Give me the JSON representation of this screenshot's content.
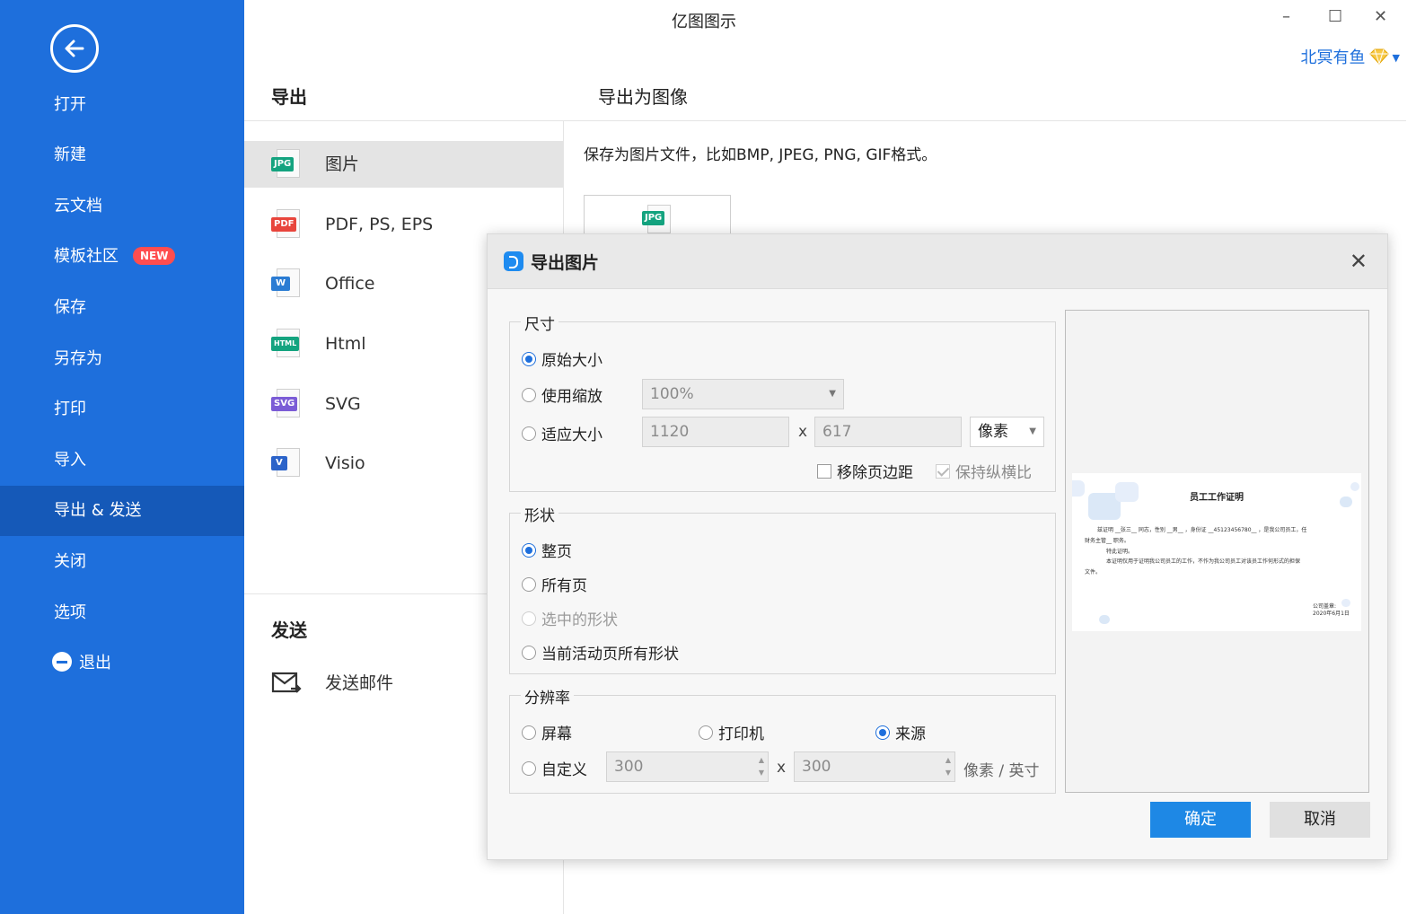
{
  "app": {
    "title": "亿图图示"
  },
  "window": {
    "minimize": "–",
    "maximize": "☐",
    "close": "✕"
  },
  "user": {
    "name": "北冥有鱼"
  },
  "sidebar": {
    "items": [
      {
        "label": "打开"
      },
      {
        "label": "新建"
      },
      {
        "label": "云文档"
      },
      {
        "label": "模板社区",
        "badge": "NEW"
      },
      {
        "label": "保存"
      },
      {
        "label": "另存为"
      },
      {
        "label": "打印"
      },
      {
        "label": "导入"
      },
      {
        "label": "导出 & 发送",
        "active": true
      },
      {
        "label": "关闭"
      },
      {
        "label": "选项"
      },
      {
        "label": "退出"
      }
    ]
  },
  "export": {
    "heading": "导出",
    "formats": [
      {
        "label": "图片",
        "tag": "JPG",
        "color": "#14a37f"
      },
      {
        "label": "PDF, PS, EPS",
        "tag": "PDF",
        "color": "#e8453c"
      },
      {
        "label": "Office",
        "tag": "W",
        "color": "#2b7cd3"
      },
      {
        "label": "Html",
        "tag": "HTML",
        "color": "#14a37f"
      },
      {
        "label": "SVG",
        "tag": "SVG",
        "color": "#7b5cd6"
      },
      {
        "label": "Visio",
        "tag": "V",
        "color": "#2b63c9"
      }
    ]
  },
  "send": {
    "heading": "发送",
    "mail_label": "发送邮件"
  },
  "right": {
    "heading": "导出为图像",
    "description": "保存为图片文件，比如BMP, JPEG, PNG, GIF格式。",
    "thumb_tag": "JPG"
  },
  "dialog": {
    "title": "导出图片",
    "close": "✕",
    "size": {
      "legend": "尺寸",
      "original": "原始大小",
      "use_scale": "使用缩放",
      "scale_value": "100%",
      "fit": "适应大小",
      "width": "1120",
      "height": "617",
      "x": "x",
      "unit": "像素",
      "remove_margin": "移除页边距",
      "keep_ratio": "保持纵横比"
    },
    "shape": {
      "legend": "形状",
      "whole_page": "整页",
      "all_pages": "所有页",
      "selected": "选中的形状",
      "current_active": "当前活动页所有形状"
    },
    "resolution": {
      "legend": "分辨率",
      "screen": "屏幕",
      "printer": "打印机",
      "source": "来源",
      "custom": "自定义",
      "dpi_x": "300",
      "dpi_y": "300",
      "x": "x",
      "unit": "像素 / 英寸"
    },
    "preview": {
      "doc_title": "员工工作证明",
      "lines": [
        "兹证明 __张三__ 同志，性别 __男__ ，身份证 __45123456780__ ，是我公司员工，任",
        "财务主管__ 职务。",
        "特此证明。",
        "本证明仅用于证明我公司员工的工作，不作为我公司员工对该员工作何形式的担保",
        "文件。",
        "公司盖章:",
        "2020年6月1日"
      ]
    },
    "ok": "确定",
    "cancel": "取消"
  },
  "colors": {
    "primary": "#1e6fdc",
    "button": "#1e88e5",
    "badge": "#ff4d4f"
  }
}
